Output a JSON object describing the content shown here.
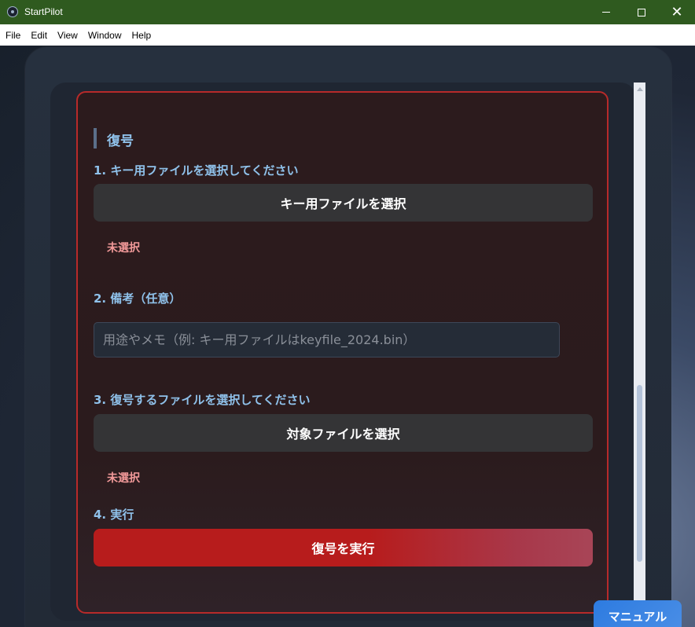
{
  "window": {
    "title": "StartPilot",
    "minimize_icon": "minimize-icon",
    "maximize_icon": "maximize-icon",
    "close_glyph": "✕"
  },
  "menubar": {
    "items": [
      "File",
      "Edit",
      "View",
      "Window",
      "Help"
    ]
  },
  "decrypt": {
    "section_title": "復号",
    "step1_label": "1. キー用ファイルを選択してください",
    "key_button": "キー用ファイルを選択",
    "key_status": "未選択",
    "step2_label": "2. 備考（任意）",
    "note_placeholder": "用途やメモ（例: キー用ファイルはkeyfile_2024.bin）",
    "note_value": "",
    "step3_label": "3. 復号するファイルを選択してください",
    "target_button": "対象ファイルを選択",
    "target_status": "未選択",
    "step4_label": "4. 実行",
    "execute_button": "復号を実行"
  },
  "manual_button": "マニュアル",
  "colors": {
    "titlebar": "#2f5a1f",
    "card_border": "#b72a2a",
    "accent_text": "#8fc1ea",
    "status_text": "#f39a9a",
    "execute": "#b71c1c",
    "manual": "#2d7be0"
  }
}
